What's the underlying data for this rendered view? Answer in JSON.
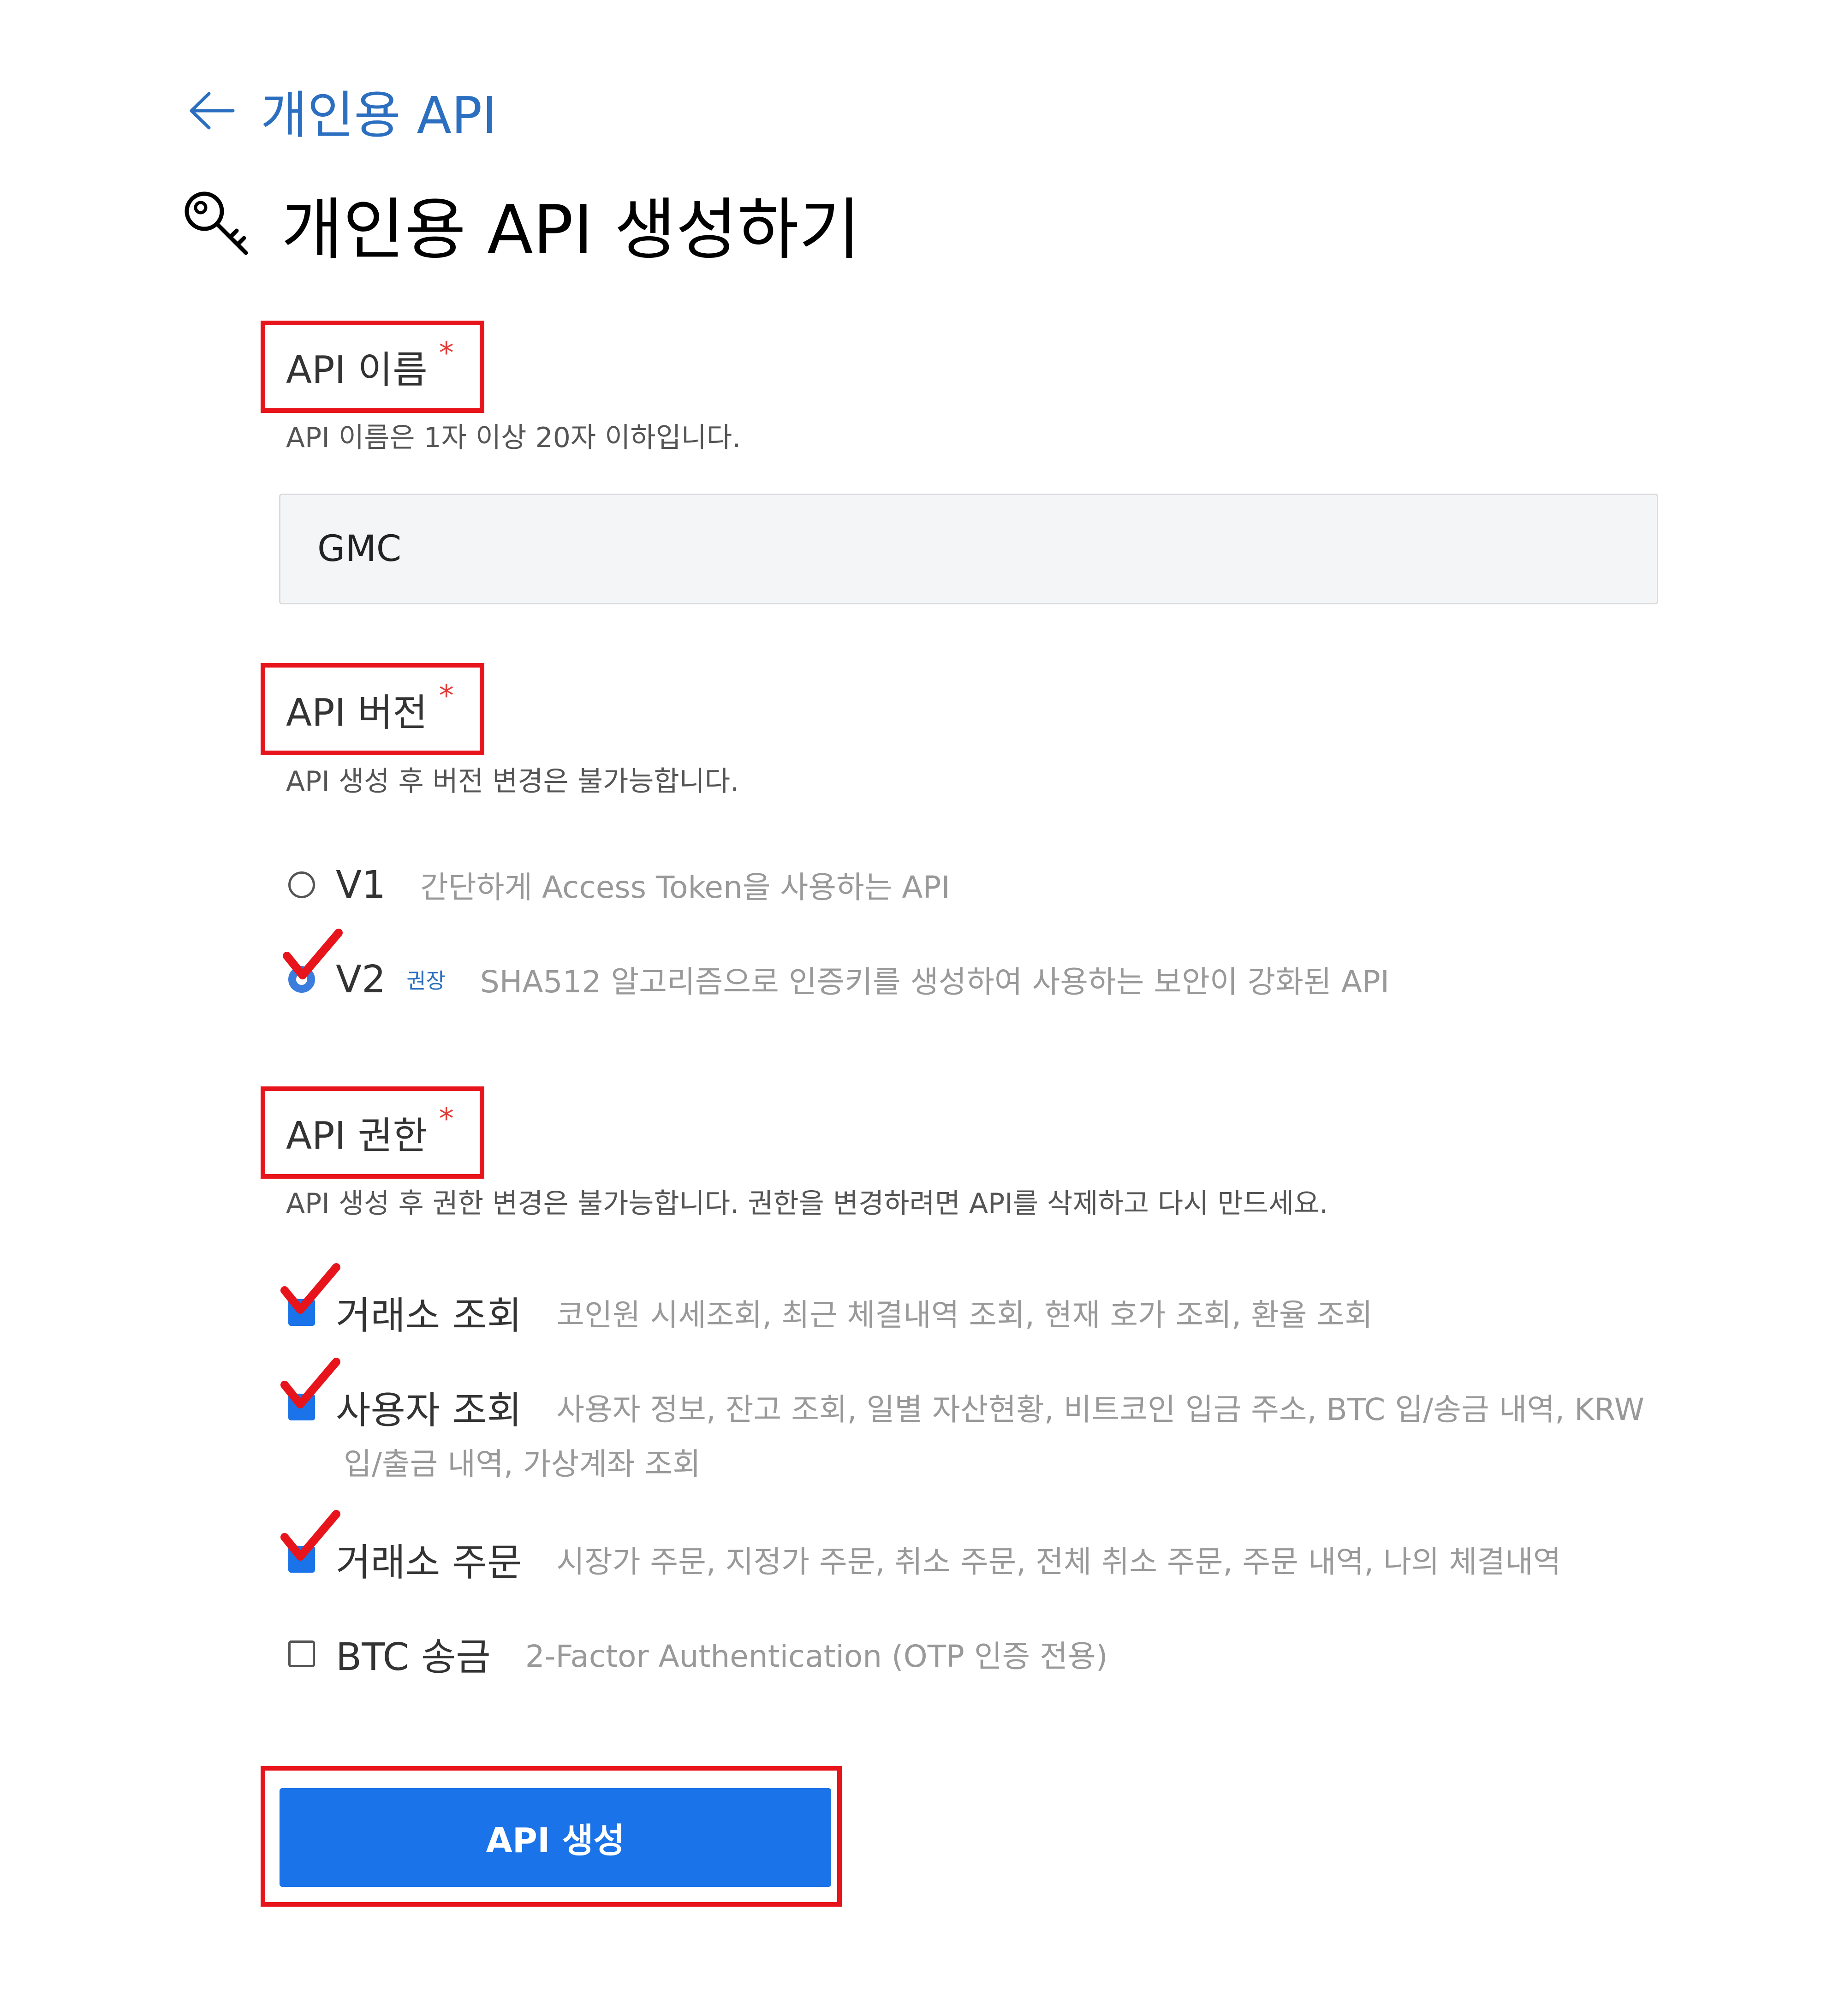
{
  "header": {
    "back_label": "개인용 API",
    "title": "개인용 API 생성하기"
  },
  "name_section": {
    "label": "API 이름",
    "required_mark": "*",
    "hint": "API 이름은 1자 이상 20자 이하입니다.",
    "value": "GMC"
  },
  "version_section": {
    "label": "API 버전",
    "required_mark": "*",
    "hint": "API 생성 후 버전 변경은 불가능합니다.",
    "options": [
      {
        "name": "V1",
        "badge": "",
        "description": "간단하게 Access Token을 사용하는 API",
        "selected": false
      },
      {
        "name": "V2",
        "badge": "권장",
        "description": "SHA512 알고리즘으로 인증키를 생성하여 사용하는 보안이 강화된 API",
        "selected": true
      }
    ]
  },
  "permission_section": {
    "label": "API 권한",
    "required_mark": "*",
    "hint": "API 생성 후 권한 변경은 불가능합니다. 권한을 변경하려면 API를 삭제하고 다시 만드세요.",
    "options": [
      {
        "name": "거래소 조회",
        "description": "코인원 시세조회, 최근 체결내역 조회, 현재 호가 조회, 환율 조회",
        "checked": true
      },
      {
        "name": "사용자 조회",
        "description": "사용자 정보, 잔고 조회, 일별 자산현황, 비트코인 입금 주소, BTC 입/송금 내역, KRW",
        "description_cont": "입/출금 내역, 가상계좌 조회",
        "checked": true
      },
      {
        "name": "거래소 주문",
        "description": "시장가 주문, 지정가 주문, 취소 주문, 전체 취소 주문, 주문 내역, 나의 체결내역",
        "checked": true
      },
      {
        "name": "BTC 송금",
        "description": "2-Factor Authentication (OTP 인증 전용)",
        "checked": false
      }
    ]
  },
  "submit": {
    "label": "API 생성"
  },
  "colors": {
    "accent": "#1a73e8",
    "highlight_box": "#e8141c",
    "required": "#e53935",
    "link": "#2c6fc0"
  },
  "icons": {
    "back": "arrow-left-icon",
    "title": "key-icon",
    "annotation": "red-checkmark-icon"
  }
}
